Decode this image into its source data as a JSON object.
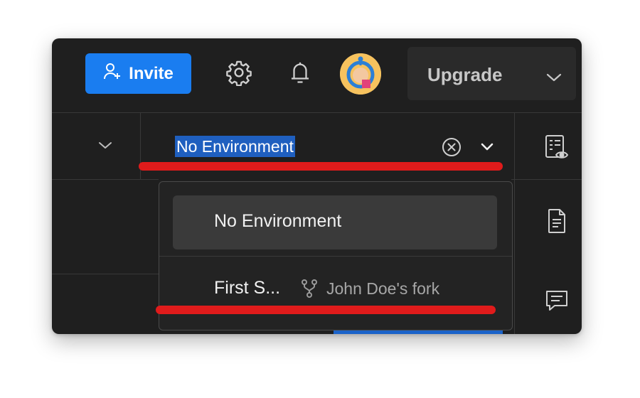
{
  "header": {
    "invite_label": "Invite",
    "upgrade_label": "Upgrade"
  },
  "environment": {
    "selected": "No Environment"
  },
  "dropdown": {
    "items": [
      {
        "label": "No Environment"
      },
      {
        "label": "First S...",
        "fork_label": "John Doe's fork"
      }
    ]
  },
  "colors": {
    "accent": "#1a7df0",
    "annotation": "#e01b1b",
    "background": "#1f1f1f"
  },
  "icons": [
    "add-user-icon",
    "gear-icon",
    "bell-icon",
    "chevron-down-icon",
    "clear-circle-icon",
    "environment-quicklook-icon",
    "document-icon",
    "comment-icon",
    "fork-icon"
  ]
}
